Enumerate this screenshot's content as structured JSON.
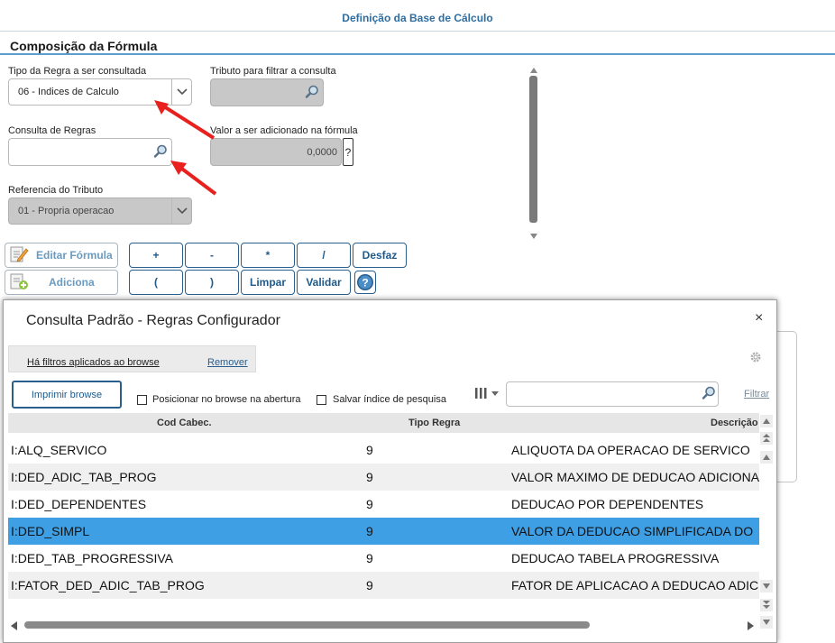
{
  "header": {
    "title": "Definição da Base de Cálculo",
    "section_title": "Composição da Fórmula"
  },
  "form": {
    "tipo_regra": {
      "label": "Tipo da Regra a ser consultada",
      "value": "06 - Indices de Calculo"
    },
    "tributo_filtro": {
      "label": "Tributo para filtrar a consulta",
      "value": ""
    },
    "consulta_regras": {
      "label": "Consulta de Regras",
      "value": ""
    },
    "valor_adicionado": {
      "label": "Valor a ser adicionado na fórmula",
      "value": "0,0000",
      "help": "?"
    },
    "referencia_tributo": {
      "label": "Referencia do Tributo",
      "value": "01 - Propria operacao"
    }
  },
  "toolbar": {
    "editar_formula": "Editar Fórmula",
    "adiciona": "Adiciona",
    "ops": [
      "+",
      "-",
      "*",
      "/",
      "Desfaz",
      "(",
      ")",
      "Limpar",
      "Validar"
    ]
  },
  "modal": {
    "title": "Consulta Padrão - Regras Configurador",
    "close": "×",
    "filter_info": "Há filtros aplicados ao browse",
    "filter_remove": "Remover",
    "print_button": "Imprimir browse",
    "check_position": "Posicionar no browse na abertura",
    "check_save_index": "Salvar índice de pesquisa",
    "search_placeholder": "",
    "filter_link": "Filtrar",
    "columns": [
      "Cod Cabec.",
      "Tipo Regra",
      "Descrição"
    ],
    "rows": [
      {
        "cod": "I:ALQ_SERVICO",
        "tipo": "9",
        "desc": "ALIQUOTA DA OPERACAO DE SERVICO"
      },
      {
        "cod": "I:DED_ADIC_TAB_PROG",
        "tipo": "9",
        "desc": "VALOR MAXIMO DE DEDUCAO ADICIONAL"
      },
      {
        "cod": "I:DED_DEPENDENTES",
        "tipo": "9",
        "desc": "DEDUCAO POR DEPENDENTES"
      },
      {
        "cod": "I:DED_SIMPL",
        "tipo": "9",
        "desc": "VALOR DA DEDUCAO SIMPLIFICADA DO"
      },
      {
        "cod": "I:DED_TAB_PROGRESSIVA",
        "tipo": "9",
        "desc": "DEDUCAO TABELA PROGRESSIVA"
      },
      {
        "cod": "I:FATOR_DED_ADIC_TAB_PROG",
        "tipo": "9",
        "desc": "FATOR DE APLICACAO A DEDUCAO ADICIONAL"
      }
    ],
    "selected_row": 3
  },
  "colors": {
    "accent": "#2f6d9f",
    "selection": "#3f9fe4",
    "arrow": "#e8211e"
  },
  "icons": [
    "search-icon",
    "chevron-down-icon",
    "help-icon",
    "close-icon",
    "gear-icon",
    "columns-icon",
    "edit-icon",
    "add-icon"
  ]
}
